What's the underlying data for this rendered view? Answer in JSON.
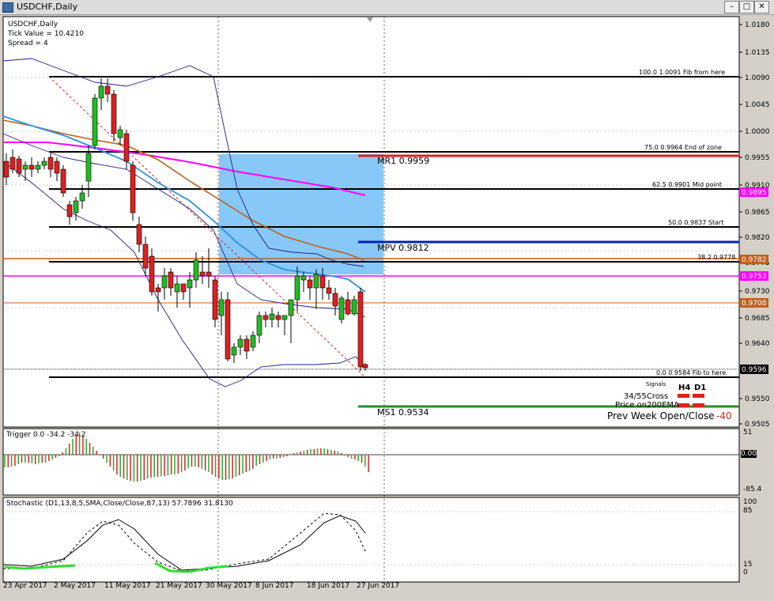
{
  "window": {
    "title": "USDCHF,Daily",
    "min": "–",
    "max": "□",
    "close": "✕"
  },
  "info": {
    "symbol": "USDCHF,Daily",
    "tick": "Tick Value = 10.4210",
    "spread": "Spread = 4"
  },
  "price_axis": [
    "1.0180",
    "1.0135",
    "1.0090",
    "1.0045",
    "1.0000",
    "0.9955",
    "0.9910",
    "0.9865",
    "0.9820",
    "0.9775",
    "0.9730",
    "0.9685",
    "0.9640",
    "0.9550",
    "0.9505"
  ],
  "price_tags": [
    {
      "value": "0.9895",
      "color": "#ff00ff"
    },
    {
      "value": "0.9782",
      "color": "#c06020"
    },
    {
      "value": "0.9753",
      "color": "#ff00ff"
    },
    {
      "value": "0.9708",
      "color": "#c06020"
    },
    {
      "value": "0.9596",
      "color": "#000000"
    }
  ],
  "fib_labels": [
    {
      "text": "100.0   1.0091     Fib from here"
    },
    {
      "text": "75.0    0.9964     End of zone"
    },
    {
      "text": "62.5    0.9901     Mid point"
    },
    {
      "text": "50.0    0.9837     Start"
    },
    {
      "text": "38.2    0.9778"
    },
    {
      "text": "0.0    0.9584     Fib to here"
    }
  ],
  "pivots": {
    "mr1": "MR1   0.9959",
    "mpv": "MPV   0.9812",
    "ms1": "MS1   0.9534"
  },
  "signals": {
    "title": "Signals",
    "h4": "H4",
    "d1": "D1",
    "cross": "34/55Cross",
    "ema": "Price on200EMA",
    "prev": "Prev Week Open/Close",
    "prev_value": "-40"
  },
  "trigger": {
    "label": "Trigger 0.0 -34.2 -34.2",
    "axis_top": "51",
    "axis_zero": "0.00",
    "axis_bottom": "-85.4"
  },
  "stochastic": {
    "label": "Stochastic (D1,13,8,5,SMA,Close/Close,87,13) 57.7896 31.8130",
    "axis": [
      "100",
      "85",
      "15",
      "0"
    ]
  },
  "time_axis": [
    "23 Apr 2017",
    "2 May 2017",
    "11 May 2017",
    "21 May 2017",
    "30 May 2017",
    "8 Jun 2017",
    "18 Jun 2017",
    "27 Jun 2017"
  ]
}
